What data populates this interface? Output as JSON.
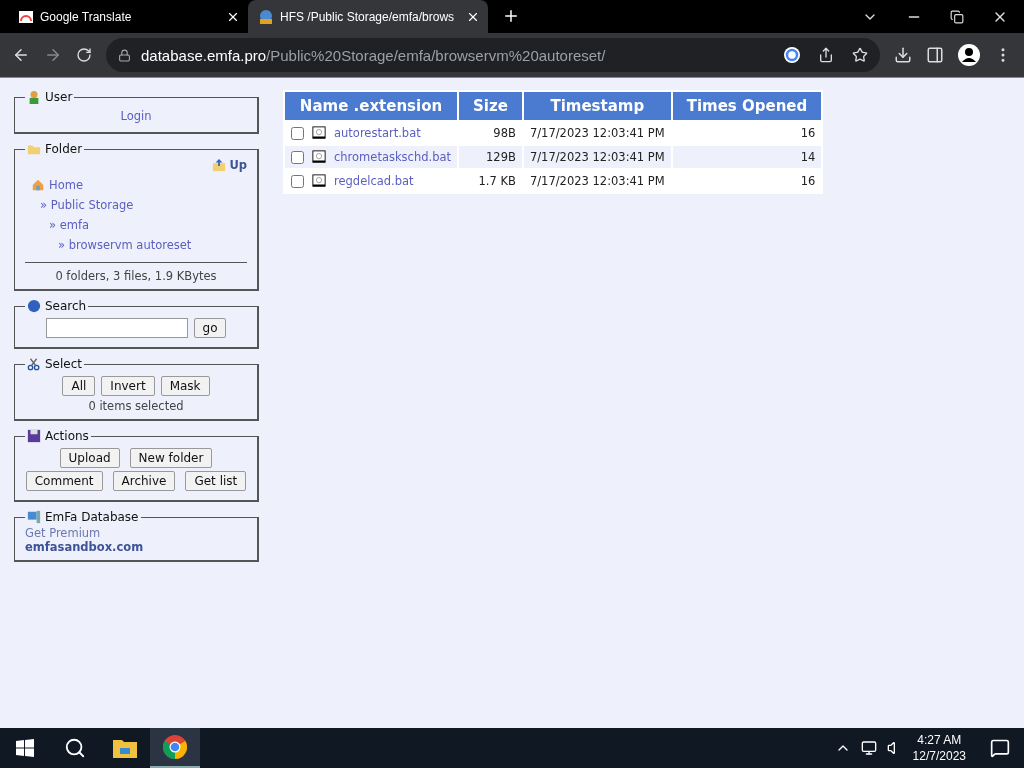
{
  "browser": {
    "tabs": [
      {
        "title": "Google Translate",
        "selected": false
      },
      {
        "title": "HFS /Public Storage/emfa/brows",
        "selected": true
      }
    ],
    "url": {
      "host": "database.emfa.pro",
      "path": "/Public%20Storage/emfa/browservm%20autoreset/"
    }
  },
  "sidebar": {
    "user": {
      "legend": "User",
      "login": "Login"
    },
    "folder": {
      "legend": "Folder",
      "up": "Up",
      "path": [
        {
          "label": "Home",
          "children": [
            {
              "label": "» Public Storage",
              "children": [
                {
                  "label": "» emfa",
                  "children": [
                    {
                      "label": "» browservm autoreset"
                    }
                  ]
                }
              ]
            }
          ]
        }
      ],
      "summary": "0 folders, 3 files, 1.9 KBytes"
    },
    "search": {
      "legend": "Search",
      "button": "go"
    },
    "select": {
      "legend": "Select",
      "buttons": [
        "All",
        "Invert",
        "Mask"
      ],
      "status": "0 items selected"
    },
    "actions": {
      "legend": "Actions",
      "rows": [
        [
          "Upload",
          "New folder"
        ],
        [
          "Comment",
          "Archive",
          "Get list"
        ]
      ]
    },
    "database": {
      "legend": "EmFa Database",
      "premium": "Get Premium",
      "site": "emfasandbox.com"
    }
  },
  "table": {
    "columns": [
      "Name .extension",
      "Size",
      "Timestamp",
      "Times Opened"
    ],
    "rows": [
      {
        "checked": false,
        "name": "autorestart.bat",
        "size": "98B",
        "timestamp": "7/17/2023 12:03:41 PM",
        "opened": "16"
      },
      {
        "checked": false,
        "name": "chrometaskschd.bat",
        "size": "129B",
        "timestamp": "7/17/2023 12:03:41 PM",
        "opened": "14"
      },
      {
        "checked": false,
        "name": "regdelcad.bat",
        "size": "1.7 KB",
        "timestamp": "7/17/2023 12:03:41 PM",
        "opened": "16"
      }
    ]
  },
  "taskbar": {
    "time": "4:27 AM",
    "date": "12/7/2023"
  }
}
